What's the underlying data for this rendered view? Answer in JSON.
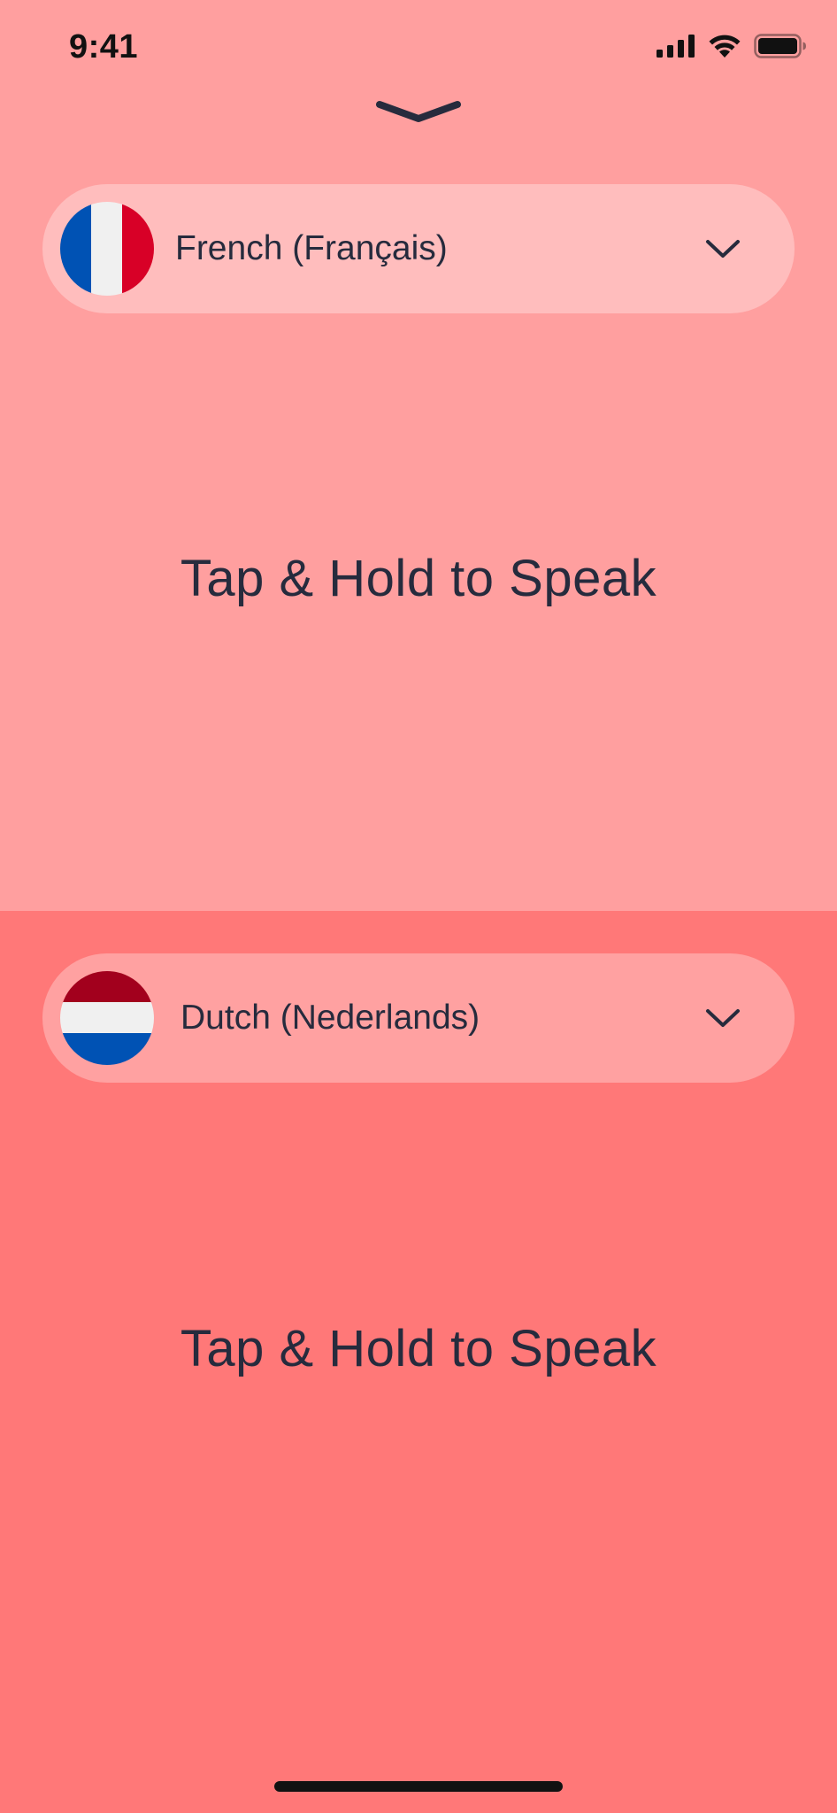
{
  "status_bar": {
    "time": "9:41"
  },
  "top_panel": {
    "language": {
      "label": "French (Français)",
      "flag": "france-flag"
    },
    "prompt": "Tap & Hold to Speak",
    "background": "#FF9F9F",
    "pill_color": "#FFBDBD"
  },
  "bottom_panel": {
    "language": {
      "label": "Dutch (Nederlands)",
      "flag": "netherlands-flag"
    },
    "prompt": "Tap & Hold to Speak",
    "background": "#FF7878",
    "pill_color": "#FFA1A1"
  },
  "colors": {
    "text": "#262B3D",
    "france_blue": "#0052B4",
    "france_white": "#F0F0F0",
    "france_red": "#D80027",
    "netherlands_red": "#A2001D",
    "netherlands_white": "#F0F0F0",
    "netherlands_blue": "#0052B4"
  }
}
